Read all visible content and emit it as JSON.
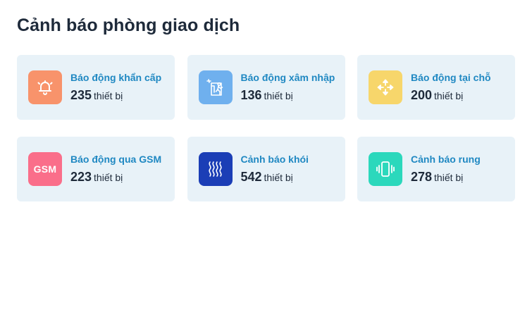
{
  "page": {
    "title": "Cảnh báo phòng giao dịch"
  },
  "cards": [
    {
      "label": "Báo động khẩn cấp",
      "count": "235",
      "unit": "thiết bị",
      "icon": "bell-icon",
      "color": "#f8936b"
    },
    {
      "label": "Báo động xâm nhập",
      "count": "136",
      "unit": "thiết bị",
      "icon": "intrusion-icon",
      "color": "#6fb0ee"
    },
    {
      "label": "Báo động tại chỗ",
      "count": "200",
      "unit": "thiết bị",
      "icon": "move-arrows-icon",
      "color": "#f7d66b"
    },
    {
      "label": "Báo động qua GSM",
      "count": "223",
      "unit": "thiết bị",
      "icon": "gsm-icon",
      "icon_text": "GSM",
      "color": "#fa6e8a"
    },
    {
      "label": "Cảnh báo khói",
      "count": "542",
      "unit": "thiết bị",
      "icon": "smoke-icon",
      "color": "#1b3eb6"
    },
    {
      "label": "Cảnh báo rung",
      "count": "278",
      "unit": "thiết bị",
      "icon": "vibration-icon",
      "color": "#2bd8bc"
    }
  ]
}
